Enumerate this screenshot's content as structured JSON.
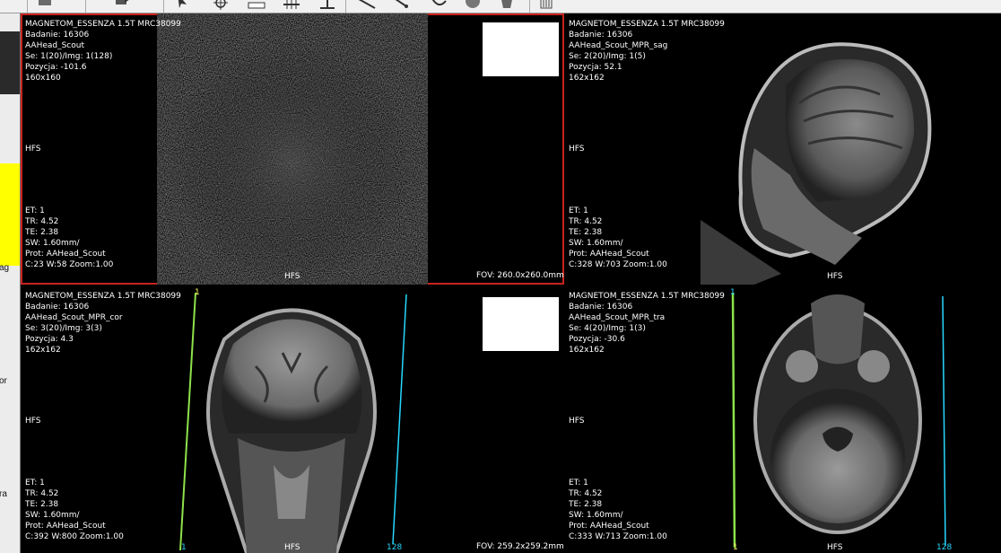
{
  "toolbar": {
    "icons": [
      "folder-open-icon",
      "export-icon",
      "cursor-icon",
      "crosshair-icon",
      "ruler-icon",
      "measure-line-icon",
      "caliper-icon",
      "angle-icon",
      "roi-icon",
      "sphere-icon",
      "bucket-icon",
      "trash-icon"
    ]
  },
  "sidebar": {
    "labels": [
      "ag",
      "or",
      "ra"
    ]
  },
  "viewports": {
    "topleft": {
      "lines": [
        "MAGNETOM_ESSENZA 1.5T MRC38099",
        "Badanie: 16306",
        "AAHead_Scout",
        "Se: 1(20)/Img: 1(128)",
        "Pozycja: -101.6",
        "160x160"
      ],
      "orient": "HFS",
      "bottom": [
        "ET: 1",
        "TR: 4.52",
        "TE: 2.38",
        "SW: 1.60mm/",
        "Prot: AAHead_Scout",
        "C:23 W:58  Zoom:1.00"
      ],
      "hfs": "HFS",
      "fov": "FOV: 260.0x260.0mm"
    },
    "topright": {
      "lines": [
        "MAGNETOM_ESSENZA 1.5T MRC38099",
        "Badanie: 16306",
        "AAHead_Scout_MPR_sag",
        "Se: 2(20)/Img: 1(5)",
        "Pozycja: 52.1",
        "162x162"
      ],
      "orient": "HFS",
      "bottom": [
        "ET: 1",
        "TR: 4.52",
        "TE: 2.38",
        "SW: 1.60mm/",
        "Prot: AAHead_Scout",
        "C:328 W:703  Zoom:1.00"
      ],
      "hfs": "HFS"
    },
    "bottomleft": {
      "lines": [
        "MAGNETOM_ESSENZA 1.5T MRC38099",
        "Badanie: 16306",
        "AAHead_Scout_MPR_cor",
        "Se: 3(20)/Img: 3(3)",
        "Pozycja: 4.3",
        "162x162"
      ],
      "orient": "HFS",
      "bottom": [
        "ET: 1",
        "TR: 4.52",
        "TE: 2.38",
        "SW: 1.60mm/",
        "Prot: AAHead_Scout",
        "C:392 W:800  Zoom:1.00"
      ],
      "hfs": "HFS",
      "fov": "FOV: 259.2x259.2mm",
      "marker_top": "1",
      "marker_bl": "1",
      "marker_br": "128"
    },
    "bottomright": {
      "lines": [
        "MAGNETOM_ESSENZA 1.5T MRC38099",
        "Badanie: 16306",
        "AAHead_Scout_MPR_tra",
        "Se: 4(20)/Img: 1(3)",
        "Pozycja: -30.6",
        "162x162"
      ],
      "orient": "HFS",
      "bottom": [
        "ET: 1",
        "TR: 4.52",
        "TE: 2.38",
        "SW: 1.60mm/",
        "Prot: AAHead_Scout",
        "C:333 W:713  Zoom:1.00"
      ],
      "hfs": "HFS",
      "marker_top": "1",
      "marker_bl": "1",
      "marker_br": "128"
    }
  }
}
